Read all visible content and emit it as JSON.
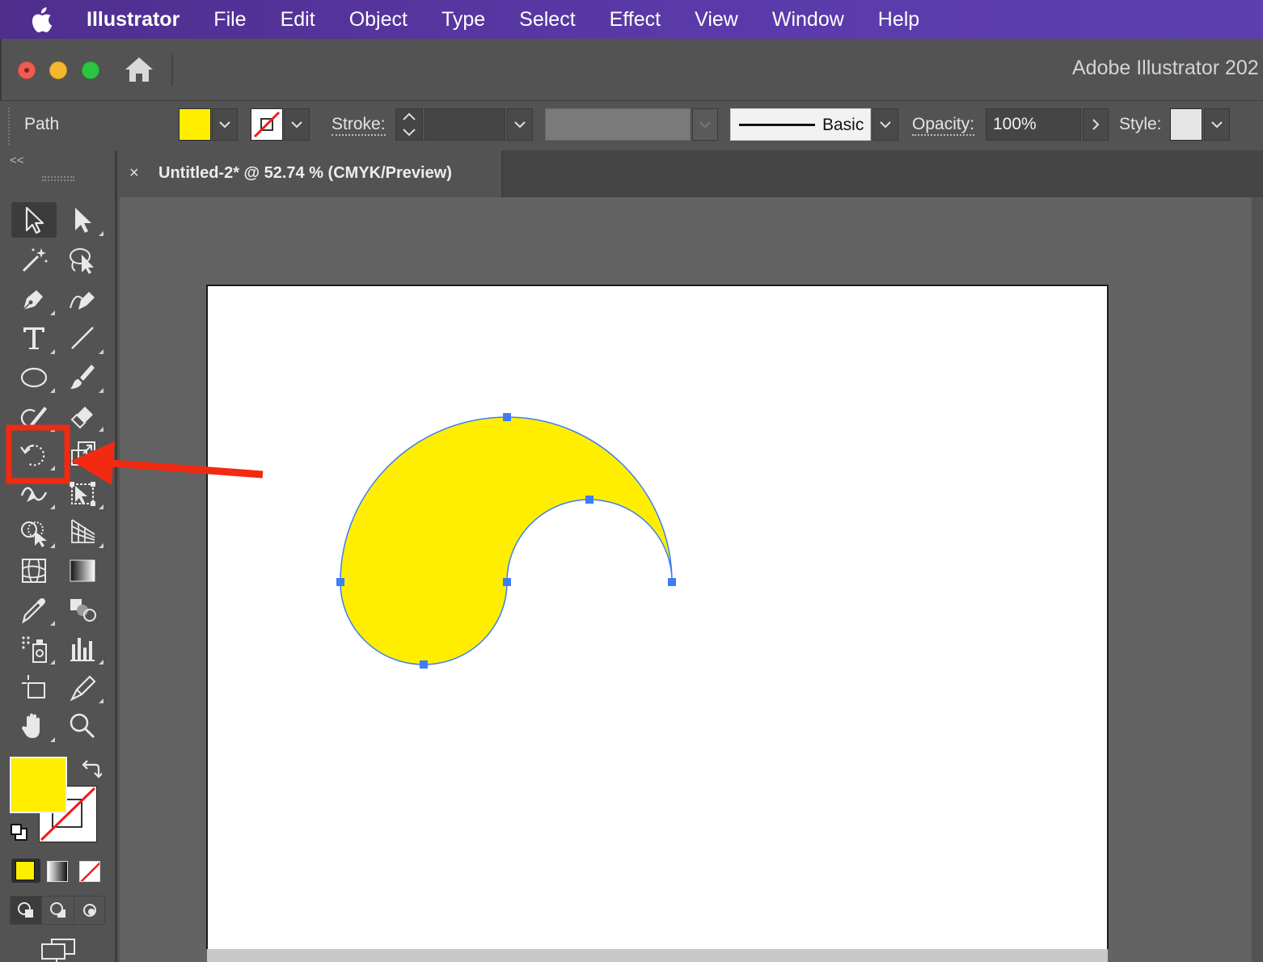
{
  "menubar": {
    "apple_icon": "apple-logo-icon",
    "items": [
      "Illustrator",
      "File",
      "Edit",
      "Object",
      "Type",
      "Select",
      "Effect",
      "View",
      "Window",
      "Help"
    ]
  },
  "titlebar": {
    "title": "Adobe Illustrator 202"
  },
  "control_bar": {
    "selection_type": "Path",
    "fill_color": "#ffee00",
    "stroke_label": "Stroke:",
    "brush_style": "Basic",
    "opacity_label": "Opacity:",
    "opacity_value": "100%",
    "style_label": "Style:"
  },
  "document": {
    "tab_close": "×",
    "tab_title": "Untitled-2* @ 52.74 % (CMYK/Preview)"
  },
  "toolbar": {
    "collapse": "<<",
    "tools": [
      "selection-tool",
      "direct-selection-tool",
      "magic-wand-tool",
      "lasso-tool",
      "pen-tool",
      "curvature-tool",
      "type-tool",
      "line-segment-tool",
      "ellipse-tool",
      "paintbrush-tool",
      "shaper-tool",
      "eraser-tool",
      "rotate-tool",
      "scale-tool",
      "width-tool",
      "free-transform-tool",
      "shape-builder-tool",
      "perspective-grid-tool",
      "mesh-tool",
      "gradient-tool",
      "eyedropper-tool",
      "blend-tool",
      "symbol-sprayer-tool",
      "column-graph-tool",
      "artboard-tool",
      "slice-tool",
      "hand-tool",
      "zoom-tool"
    ],
    "active_tool": "selection-tool",
    "highlighted_tool": "rotate-tool",
    "fill_color": "#ffee00",
    "stroke": "none"
  },
  "colors": {
    "fill": "#ffee00",
    "selection": "#3d7ef5",
    "annotation": "#f22a12"
  }
}
